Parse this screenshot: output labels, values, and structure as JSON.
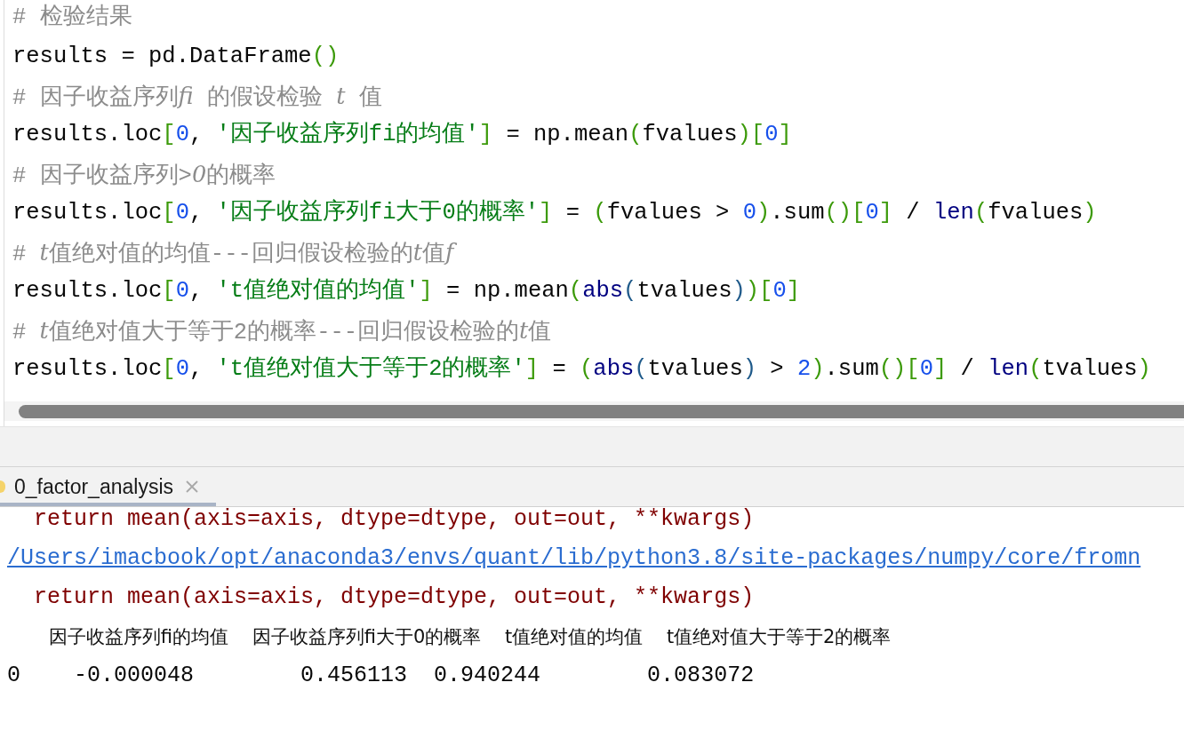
{
  "editor": {
    "lines": [
      [
        {
          "kind": "comment",
          "text": "# 检验结果"
        }
      ],
      [
        {
          "kind": "plain",
          "text": "results = pd.DataFrame"
        },
        {
          "kind": "paren",
          "text": "()"
        }
      ],
      [
        {
          "kind": "comment",
          "text": "# 因子收益序列"
        },
        {
          "kind": "math",
          "text": "fi"
        },
        {
          "kind": "comment",
          "text": " 的假设检验 "
        },
        {
          "kind": "math",
          "text": "t"
        },
        {
          "kind": "comment",
          "text": " 值"
        }
      ],
      [
        {
          "kind": "plain",
          "text": "results.loc"
        },
        {
          "kind": "paren",
          "text": "["
        },
        {
          "kind": "number",
          "text": "0"
        },
        {
          "kind": "plain",
          "text": ", "
        },
        {
          "kind": "string",
          "text": "'因子收益序列fi的均值'"
        },
        {
          "kind": "paren",
          "text": "]"
        },
        {
          "kind": "plain",
          "text": " = np.mean"
        },
        {
          "kind": "paren",
          "text": "("
        },
        {
          "kind": "plain",
          "text": "fvalues"
        },
        {
          "kind": "paren",
          "text": ")["
        },
        {
          "kind": "number",
          "text": "0"
        },
        {
          "kind": "paren",
          "text": "]"
        }
      ],
      [
        {
          "kind": "comment",
          "text": "# 因子收益序列>"
        },
        {
          "kind": "math",
          "text": "0"
        },
        {
          "kind": "comment",
          "text": "的概率"
        }
      ],
      [
        {
          "kind": "plain",
          "text": "results.loc"
        },
        {
          "kind": "paren",
          "text": "["
        },
        {
          "kind": "number",
          "text": "0"
        },
        {
          "kind": "plain",
          "text": ", "
        },
        {
          "kind": "string",
          "text": "'因子收益序列fi大于0的概率'"
        },
        {
          "kind": "paren",
          "text": "]"
        },
        {
          "kind": "plain",
          "text": " = "
        },
        {
          "kind": "paren",
          "text": "("
        },
        {
          "kind": "plain",
          "text": "fvalues > "
        },
        {
          "kind": "number",
          "text": "0"
        },
        {
          "kind": "paren",
          "text": ")"
        },
        {
          "kind": "plain",
          "text": ".sum"
        },
        {
          "kind": "paren",
          "text": "()["
        },
        {
          "kind": "number",
          "text": "0"
        },
        {
          "kind": "paren",
          "text": "]"
        },
        {
          "kind": "plain",
          "text": " / "
        },
        {
          "kind": "builtin",
          "text": "len"
        },
        {
          "kind": "paren",
          "text": "("
        },
        {
          "kind": "plain",
          "text": "fvalues"
        },
        {
          "kind": "paren",
          "text": ")"
        }
      ],
      [
        {
          "kind": "comment",
          "text": "# "
        },
        {
          "kind": "math",
          "text": "t"
        },
        {
          "kind": "comment",
          "text": "值绝对值的均值---回归假设检验的"
        },
        {
          "kind": "math",
          "text": "t"
        },
        {
          "kind": "comment",
          "text": "值"
        },
        {
          "kind": "math",
          "text": "f"
        }
      ],
      [
        {
          "kind": "plain",
          "text": "results.loc"
        },
        {
          "kind": "paren",
          "text": "["
        },
        {
          "kind": "number",
          "text": "0"
        },
        {
          "kind": "plain",
          "text": ", "
        },
        {
          "kind": "string",
          "text": "'t值绝对值的均值'"
        },
        {
          "kind": "paren",
          "text": "]"
        },
        {
          "kind": "plain",
          "text": " = np.mean"
        },
        {
          "kind": "paren",
          "text": "("
        },
        {
          "kind": "builtin",
          "text": "abs"
        },
        {
          "kind": "paren2",
          "text": "("
        },
        {
          "kind": "plain",
          "text": "tvalues"
        },
        {
          "kind": "paren2",
          "text": ")"
        },
        {
          "kind": "paren",
          "text": ")["
        },
        {
          "kind": "number",
          "text": "0"
        },
        {
          "kind": "paren",
          "text": "]"
        }
      ],
      [
        {
          "kind": "comment",
          "text": "# "
        },
        {
          "kind": "math",
          "text": "t"
        },
        {
          "kind": "comment",
          "text": "值绝对值大于等于2的概率---回归假设检验的"
        },
        {
          "kind": "math",
          "text": "t"
        },
        {
          "kind": "comment",
          "text": "值"
        }
      ],
      [
        {
          "kind": "plain",
          "text": "results.loc"
        },
        {
          "kind": "paren",
          "text": "["
        },
        {
          "kind": "number",
          "text": "0"
        },
        {
          "kind": "plain",
          "text": ", "
        },
        {
          "kind": "string",
          "text": "'t值绝对值大于等于2的概率'"
        },
        {
          "kind": "paren",
          "text": "]"
        },
        {
          "kind": "plain",
          "text": " = "
        },
        {
          "kind": "paren",
          "text": "("
        },
        {
          "kind": "builtin",
          "text": "abs"
        },
        {
          "kind": "paren2",
          "text": "("
        },
        {
          "kind": "plain",
          "text": "tvalues"
        },
        {
          "kind": "paren2",
          "text": ")"
        },
        {
          "kind": "plain",
          "text": " > "
        },
        {
          "kind": "number",
          "text": "2"
        },
        {
          "kind": "paren",
          "text": ")"
        },
        {
          "kind": "plain",
          "text": ".sum"
        },
        {
          "kind": "paren",
          "text": "()["
        },
        {
          "kind": "number",
          "text": "0"
        },
        {
          "kind": "paren",
          "text": "]"
        },
        {
          "kind": "plain",
          "text": " / "
        },
        {
          "kind": "builtin",
          "text": "len"
        },
        {
          "kind": "paren",
          "text": "("
        },
        {
          "kind": "plain",
          "text": "tvalues"
        },
        {
          "kind": "paren",
          "text": ")"
        }
      ]
    ]
  },
  "run_tabs": [
    {
      "label": "0_factor_analysis",
      "selected": true
    }
  ],
  "console": {
    "lines": [
      {
        "kind": "error",
        "text": "  return mean(axis=axis, dtype=dtype, out=out, **kwargs)"
      },
      {
        "kind": "link",
        "text": "/Users/imacbook/opt/anaconda3/envs/quant/lib/python3.8/site-packages/numpy/core/fromn"
      },
      {
        "kind": "error",
        "text": "  return mean(axis=axis, dtype=dtype, out=out, **kwargs)"
      },
      {
        "kind": "header",
        "text": "       因子收益序列fi的均值    因子收益序列fi大于0的概率    t值绝对值的均值    t值绝对值大于等于2的概率"
      },
      {
        "kind": "output",
        "text": "0    -0.000048        0.456113  0.940244        0.083072"
      }
    ]
  }
}
